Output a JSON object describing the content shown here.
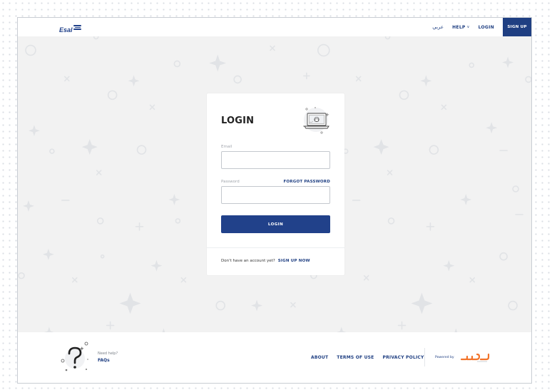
{
  "header": {
    "logo_text": "Esal",
    "nav": {
      "arabic_label": "عربي",
      "help_label": "HELP",
      "login_label": "LOGIN",
      "signup_label": "SIGN UP"
    }
  },
  "login_card": {
    "title": "LOGIN",
    "email_label": "Email",
    "email_value": "",
    "password_label": "Password",
    "password_value": "",
    "forgot_password_label": "FORGOT PASSWORD",
    "submit_label": "LOGIN",
    "no_account_text": "Don't have an account yet?",
    "signup_now_label": "SIGN UP NOW"
  },
  "footer": {
    "need_help_text": "Need help?",
    "faqs_label": "FAQs",
    "links": [
      "ABOUT",
      "TERMS OF USE",
      "PRIVACY POLICY"
    ],
    "powered_by_text": "Powered by",
    "partner_logo": "سداد"
  },
  "icons": {
    "logo": "esal-logo-icon",
    "help_chevron": "chevron-down-icon",
    "card_illustration": "laptop-lock-icon",
    "help_illustration": "question-mark-icon",
    "partner": "sadad-logo-icon"
  },
  "colors": {
    "brand_navy": "#1f3f82",
    "page_bg": "#f2f2f2",
    "sadad_orange": "#f2742b"
  }
}
